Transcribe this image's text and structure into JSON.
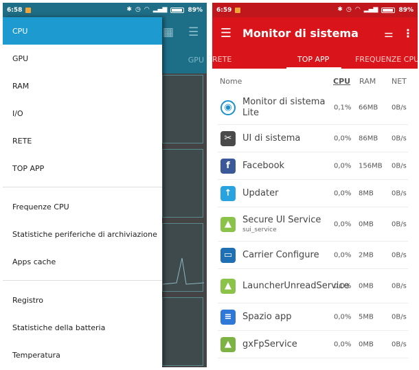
{
  "left": {
    "status": {
      "time": "6:58",
      "battery": "89%"
    },
    "bg_tab": "GPU",
    "drawer": {
      "group1": [
        "CPU",
        "GPU",
        "RAM",
        "I/O",
        "RETE",
        "TOP APP"
      ],
      "group2": [
        "Frequenze CPU",
        "Statistiche periferiche di archiviazione",
        "Apps cache"
      ],
      "group3": [
        "Registro",
        "Statistiche della batteria",
        "Temperatura"
      ]
    }
  },
  "right": {
    "status": {
      "time": "6:59",
      "battery": "89%"
    },
    "toolbar": {
      "title": "Monitor di sistema"
    },
    "tabs": [
      "RETE",
      "TOP APP",
      "FREQUENZE CPU"
    ],
    "header": {
      "name": "Nome",
      "cpu": "CPU",
      "ram": "RAM",
      "net": "NET"
    },
    "apps": [
      {
        "name": "Monitor di sistema Lite",
        "sub": "",
        "cpu": "0,1%",
        "ram": "66MB",
        "net": "0B/s",
        "icon": "monitor-app-icon",
        "color": "#ffffff"
      },
      {
        "name": "UI di sistema",
        "sub": "",
        "cpu": "0,0%",
        "ram": "86MB",
        "net": "0B/s",
        "icon": "system-ui-icon",
        "color": "#4a4a4a"
      },
      {
        "name": "Facebook",
        "sub": "",
        "cpu": "0,0%",
        "ram": "156MB",
        "net": "0B/s",
        "icon": "facebook-icon",
        "color": "#3b5998"
      },
      {
        "name": "Updater",
        "sub": "",
        "cpu": "0,0%",
        "ram": "8MB",
        "net": "0B/s",
        "icon": "updater-icon",
        "color": "#29a3e0"
      },
      {
        "name": "Secure UI Service",
        "sub": "sui_service",
        "cpu": "0,0%",
        "ram": "0MB",
        "net": "0B/s",
        "icon": "android-icon",
        "color": "#8bc34a"
      },
      {
        "name": "Carrier Configure",
        "sub": "",
        "cpu": "0,0%",
        "ram": "2MB",
        "net": "0B/s",
        "icon": "carrier-config-icon",
        "color": "#1f6fb5"
      },
      {
        "name": "LauncherUnreadService",
        "sub": "",
        "cpu": "0,0%",
        "ram": "0MB",
        "net": "0B/s",
        "icon": "android-icon",
        "color": "#8bc34a"
      },
      {
        "name": "Spazio app",
        "sub": "",
        "cpu": "0,0%",
        "ram": "5MB",
        "net": "0B/s",
        "icon": "app-space-icon",
        "color": "#2e78d8"
      },
      {
        "name": "gxFpService",
        "sub": "",
        "cpu": "0,0%",
        "ram": "0MB",
        "net": "0B/s",
        "icon": "android-icon",
        "color": "#7cb342"
      }
    ]
  }
}
